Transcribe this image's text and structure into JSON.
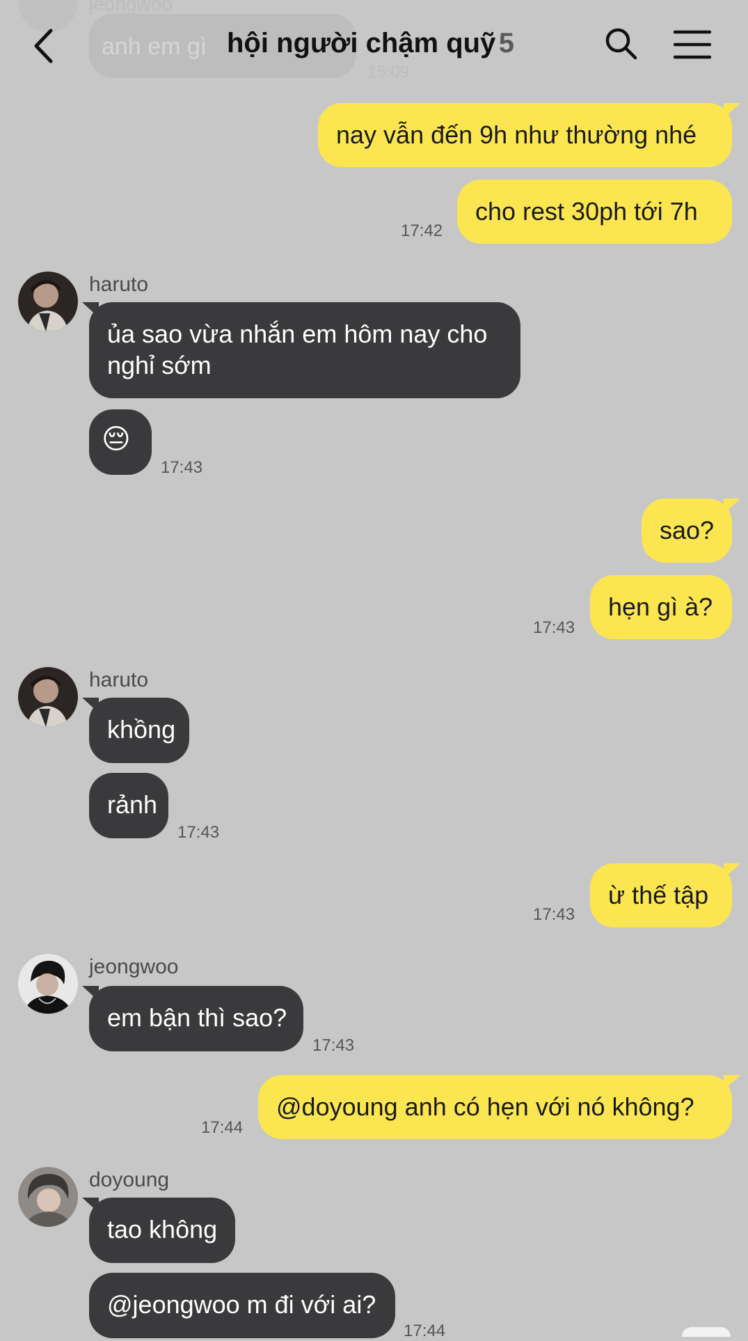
{
  "header": {
    "title": "hội người chậm quỹ",
    "member_count": "5",
    "icons": [
      "back-arrow-icon",
      "search-icon",
      "menu-icon"
    ]
  },
  "faded_top": {
    "sender": "jeongwoo",
    "text": "anh em gì",
    "time": "15:09"
  },
  "colors": {
    "background": "#c7c7c7",
    "outgoing_bubble": "#fbe652",
    "incoming_bubble": "#3a3a3c"
  },
  "messages": [
    {
      "from": "me",
      "text": "nay vẫn đến 9h như thường nhé"
    },
    {
      "from": "me",
      "text": "cho rest 30ph tới 7h",
      "time": "17:42"
    },
    {
      "from": "haruto",
      "sender": "haruto",
      "line1": "ủa sao vừa nhắn em hôm nay cho",
      "line2": "nghỉ sớm"
    },
    {
      "from": "haruto",
      "text": "😔",
      "time": "17:43"
    },
    {
      "from": "me",
      "text": "sao?"
    },
    {
      "from": "me",
      "text": "hẹn gì à?",
      "time": "17:43"
    },
    {
      "from": "haruto",
      "sender": "haruto",
      "text": "khồng"
    },
    {
      "from": "haruto",
      "text": "rảnh",
      "time": "17:43"
    },
    {
      "from": "me",
      "text": "ừ thế tập",
      "time": "17:43"
    },
    {
      "from": "jeongwoo",
      "sender": "jeongwoo",
      "text": "em bận thì sao?",
      "time": "17:43"
    },
    {
      "from": "me",
      "text": "@doyoung anh có hẹn với nó không?",
      "time": "17:44"
    },
    {
      "from": "doyoung",
      "sender": "doyoung",
      "text": "tao không"
    },
    {
      "from": "doyoung",
      "text": "@jeongwoo m đi với ai?",
      "time": "17:44"
    }
  ]
}
